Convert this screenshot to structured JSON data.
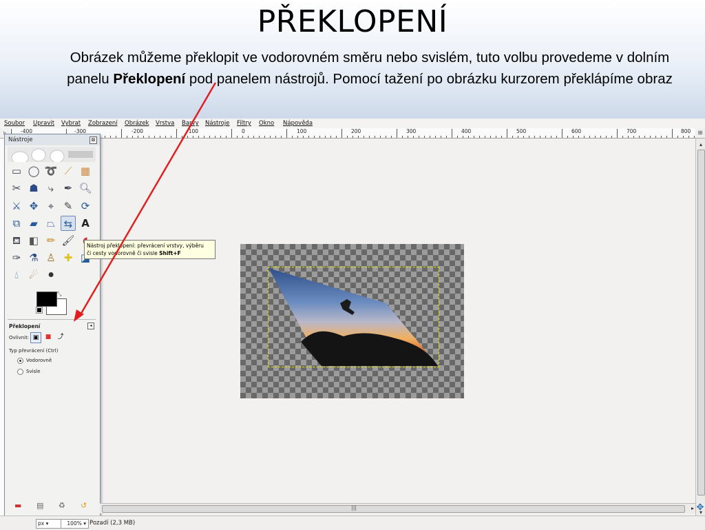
{
  "slide": {
    "title": "PŘEKLOPENÍ",
    "desc_before": "Obrázek můžeme překlopit ve vodorovném směru nebo svislém, tuto volbu provedeme v dolním panelu ",
    "desc_bold": "Překlopení",
    "desc_after": " pod panelem nástrojů. Pomocí tažení po obrázku kurzorem překlápíme obraz"
  },
  "menubar": {
    "items": [
      "Soubor",
      "Upravit",
      "Vybrat",
      "Zobrazení",
      "Obrázek",
      "Vrstva",
      "Barvy",
      "Nástroje",
      "Filtry",
      "Okno",
      "Nápověda"
    ]
  },
  "ruler": {
    "labels": [
      "-400",
      "-300",
      "-200",
      "-100",
      "0",
      "100",
      "200",
      "300",
      "400",
      "500",
      "600",
      "700",
      "800"
    ]
  },
  "toolbox": {
    "title": "Nástroje",
    "close": "⊠",
    "options_title": "Překlopení",
    "options_menu": "◂",
    "affect_label": "Ovlivnit:",
    "type_label": "Typ převrácení  (Ctrl)",
    "radio_horizontal": "Vodorovně",
    "radio_vertical": "Svisle",
    "selected_flip_type": "Vodorovně",
    "tools": [
      "rect-select-icon",
      "ellipse-select-icon",
      "lasso-icon",
      "fuzzy-select-icon",
      "color-select-icon",
      "scissors-icon",
      "foreground-select-icon",
      "paths-icon",
      "color-picker-icon",
      "zoom-icon",
      "measure-icon",
      "move-icon",
      "align-icon",
      "crop-icon",
      "rotate-icon",
      "scale-icon",
      "shear-icon",
      "perspective-icon",
      "flip-icon",
      "text-icon",
      "bucket-fill-icon",
      "blend-icon",
      "pencil-icon",
      "paintbrush-icon",
      "eraser-icon",
      "airbrush-icon",
      "ink-icon",
      "clone-icon",
      "heal-icon",
      "perspective-clone-icon",
      "blur-icon",
      "smudge-icon",
      "dodge-burn-icon"
    ],
    "active_tool": "flip-icon"
  },
  "tooltip": {
    "line1": "Nástroj překlopení: převrácení vrstvy, výběru",
    "line2": "či cesty vodorovně či svisle ",
    "shortcut": "Shift+F"
  },
  "statusbar": {
    "unit": "px ▾",
    "zoom": "100% ▾",
    "message": "Pozadí (2,3 MB)"
  },
  "colors": {
    "arrow": "#e02020",
    "selection_border": "#e3e000",
    "tooltip_bg": "#ffffe1"
  }
}
